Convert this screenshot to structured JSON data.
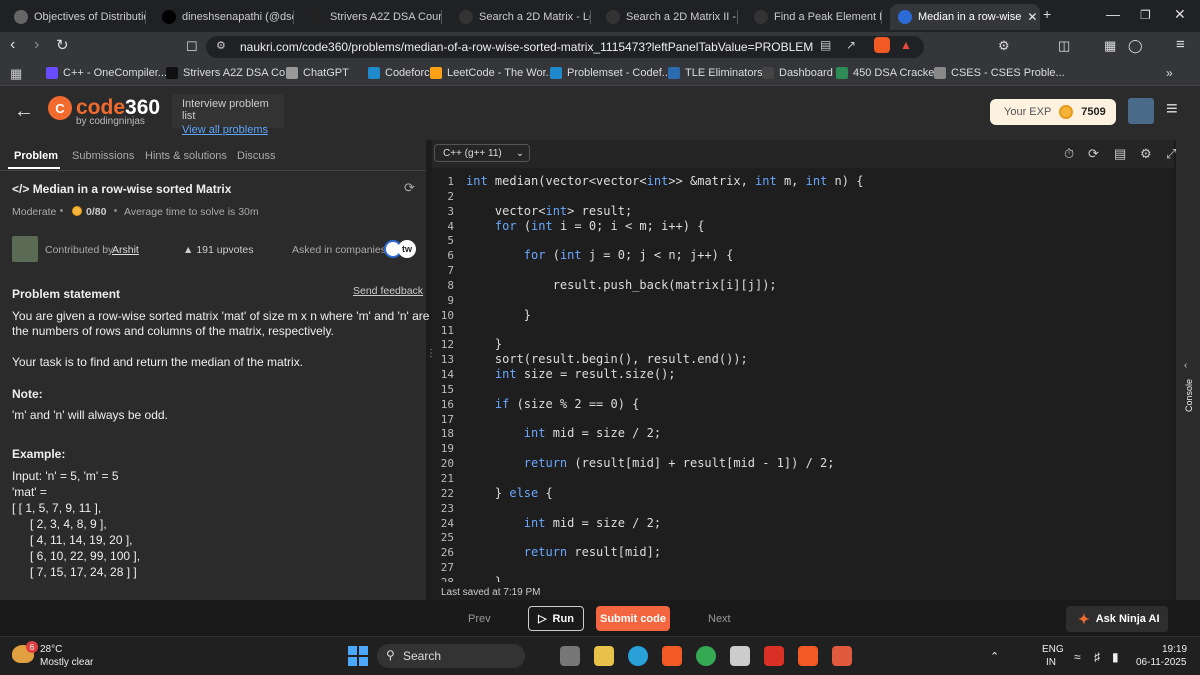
{
  "browser": {
    "tabs": [
      {
        "title": "Objectives of Distribution",
        "color": "#666666"
      },
      {
        "title": "dineshsenapathi (@dsenap",
        "color": "#000000"
      },
      {
        "title": "Strivers A2Z DSA Course/S",
        "color": "#222222"
      },
      {
        "title": "Search a 2D Matrix - LeetC",
        "color": "#333333"
      },
      {
        "title": "Search a 2D Matrix II - Lee",
        "color": "#333333"
      },
      {
        "title": "Find a Peak Element II - Le",
        "color": "#333333"
      },
      {
        "title": "Median in a row-wise",
        "color": "#2c6bd6"
      }
    ],
    "new_tab": "+",
    "window_controls": {
      "minimize": "—",
      "maximize": "❐",
      "close": "✕"
    },
    "url": "naukri.com/code360/problems/median-of-a-row-wise-sorted-matrix_1115473?leftPanelTabValue=PROBLEM",
    "bookmarks": [
      {
        "label": "C++ - OneCompiler...",
        "color": "#6a4cff"
      },
      {
        "label": "Strivers A2Z DSA Co...",
        "color": "#111111"
      },
      {
        "label": "ChatGPT",
        "color": "#999999"
      },
      {
        "label": "Codeforces",
        "color": "#1f8acb"
      },
      {
        "label": "LeetCode - The Wor...",
        "color": "#ffa116"
      },
      {
        "label": "Problemset - Codef...",
        "color": "#1f8acb"
      },
      {
        "label": "TLE Eliminators",
        "color": "#2b6cb0"
      },
      {
        "label": "Dashboard",
        "color": "#444444"
      },
      {
        "label": "450 DSA Cracker",
        "color": "#2e8b57"
      },
      {
        "label": "CSES - CSES Proble...",
        "color": "#888888"
      }
    ],
    "more_bookmarks": "»"
  },
  "header": {
    "logo_main": "code",
    "logo_num": "360",
    "logo_sub": "by codingninjas",
    "interview_title": "Interview problem list",
    "interview_link": "View all problems",
    "exp_label": "Your EXP",
    "exp_value": "7509"
  },
  "left_panel": {
    "tabs": [
      "Problem",
      "Submissions",
      "Hints & solutions",
      "Discuss"
    ],
    "active_tab": "Problem",
    "title": "Median in a row-wise sorted Matrix",
    "difficulty": "Moderate",
    "score": "0/80",
    "avg_time": "Average time to solve is 30m",
    "contributed_by_label": "Contributed by",
    "contributor": "Arshit",
    "upvotes": "191 upvotes",
    "asked_in": "Asked in companies",
    "problem_statement_heading": "Problem statement",
    "send_feedback": "Send feedback",
    "statement_line1": "You are given a row-wise sorted matrix 'mat' of size m x n where 'm' and 'n' are",
    "statement_line2": "the numbers of rows and columns of the matrix, respectively.",
    "task": "Your task is to find and return the median of the matrix.",
    "note_heading": "Note:",
    "note": "'m' and 'n' will always be odd.",
    "example_heading": "Example:",
    "example_input": "Input: 'n' = 5, 'm' = 5",
    "example_mat_label": "'mat' =",
    "example_rows": [
      "[    [ 1, 5, 7, 9, 11 ],",
      "[ 2, 3, 4, 8, 9 ],",
      "[ 4, 11, 14, 19, 20 ],",
      "[ 6, 10, 22, 99, 100 ],",
      "[ 7, 15, 17, 24, 28 ]  ]"
    ]
  },
  "editor": {
    "language": "C++ (g++ 11)",
    "code_lines": [
      "int median(vector<vector<int>> &matrix, int m, int n) {",
      "",
      "    vector<int> result;",
      "    for (int i = 0; i < m; i++) {",
      "",
      "        for (int j = 0; j < n; j++) {",
      "",
      "            result.push_back(matrix[i][j]);",
      "",
      "        }",
      "",
      "    }",
      "    sort(result.begin(), result.end());",
      "    int size = result.size();",
      "",
      "    if (size % 2 == 0) {",
      "",
      "        int mid = size / 2;",
      "",
      "        return (result[mid] + result[mid - 1]) / 2;",
      "",
      "    } else {",
      "",
      "        int mid = size / 2;",
      "",
      "        return result[mid];",
      "",
      "    }"
    ],
    "last_saved": "Last saved at 7:19 PM",
    "console_label": "Console"
  },
  "actions": {
    "prev": "Prev",
    "run": "Run",
    "submit": "Submit code",
    "next": "Next",
    "ask_ninja": "Ask Ninja AI"
  },
  "taskbar": {
    "weather_temp": "28°C",
    "weather_desc": "Mostly clear",
    "weather_badge": "6",
    "search": "Search",
    "lang": "ENG",
    "region": "IN",
    "time": "19:19",
    "date": "06-11-2025"
  }
}
